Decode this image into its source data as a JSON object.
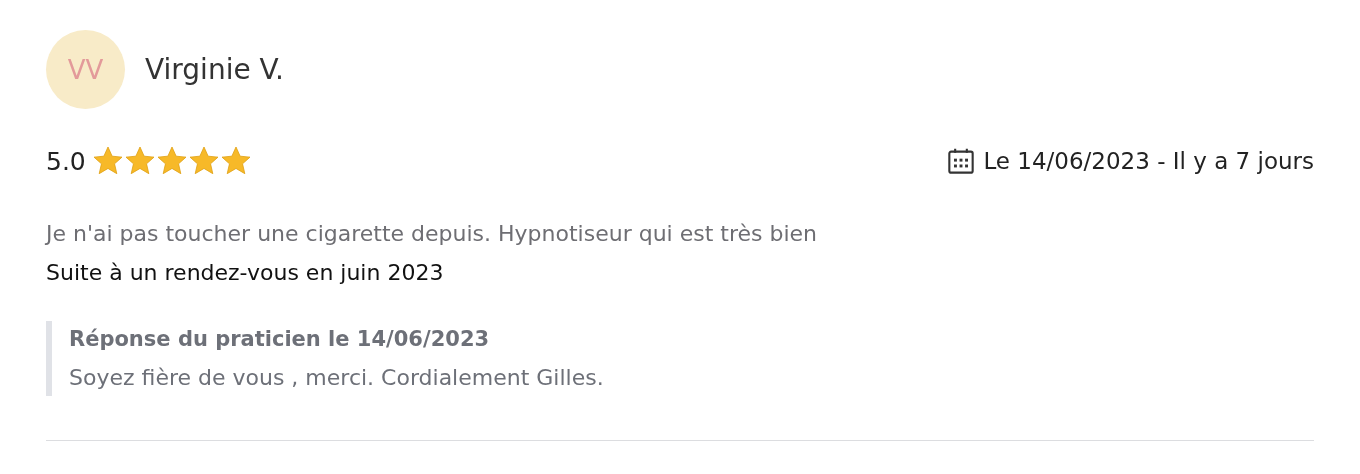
{
  "review": {
    "avatar_initials": "VV",
    "author": "Virginie V.",
    "rating": "5.0",
    "stars": 5,
    "date": "Le 14/06/2023 - Il y a 7 jours",
    "comment": "Je n'ai pas toucher une cigarette depuis. Hypnotiseur qui est très bien",
    "context": "Suite à un rendez-vous en juin 2023",
    "reply": {
      "heading": "Réponse du praticien le 14/06/2023",
      "text": "Soyez fière de vous , merci. Cordialement Gilles."
    }
  }
}
